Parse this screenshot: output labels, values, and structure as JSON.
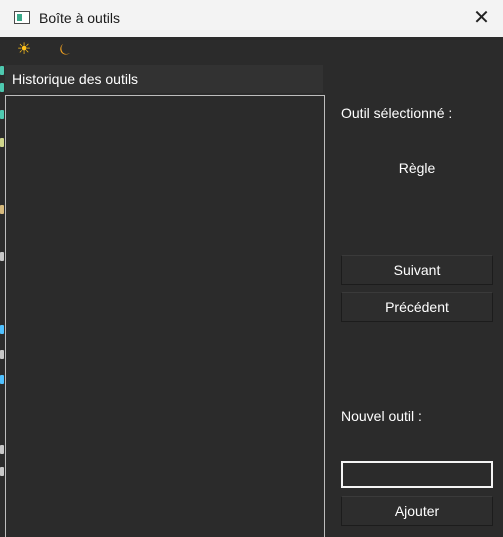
{
  "window": {
    "title": "Boîte à outils",
    "close_glyph": "✕"
  },
  "toolbar": {
    "light_theme_icon": "☀",
    "dark_theme_icon": "⏾"
  },
  "history": {
    "header": "Historique des outils",
    "items": []
  },
  "selection": {
    "label": "Outil sélectionné :",
    "value": "Règle"
  },
  "buttons": {
    "next": "Suivant",
    "previous": "Précédent",
    "add": "Ajouter"
  },
  "new_tool": {
    "label": "Nouvel outil :",
    "value": "",
    "placeholder": ""
  },
  "colors": {
    "background": "#2b2b2b",
    "titlebar": "#f3f3f3",
    "sun": "#ffc21a",
    "moon": "#f0a020"
  }
}
